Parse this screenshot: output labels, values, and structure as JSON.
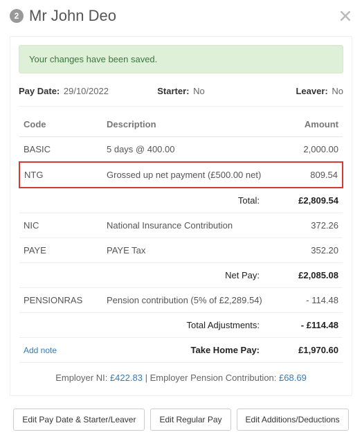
{
  "header": {
    "step_number": "2",
    "title": "Mr John Deo"
  },
  "alert": {
    "message": "Your changes have been saved."
  },
  "meta": {
    "pay_date_label": "Pay Date:",
    "pay_date_value": "29/10/2022",
    "starter_label": "Starter:",
    "starter_value": "No",
    "leaver_label": "Leaver:",
    "leaver_value": "No"
  },
  "table": {
    "head": {
      "code": "Code",
      "description": "Description",
      "amount": "Amount"
    },
    "groups": [
      {
        "rows": [
          {
            "code": "BASIC",
            "description": "5 days @ 400.00",
            "amount": "2,000.00",
            "highlight": false
          },
          {
            "code": "NTG",
            "description": "Grossed up net payment (£500.00 net)",
            "amount": "809.54",
            "highlight": true
          }
        ],
        "summary": {
          "label": "Total:",
          "amount": "£2,809.54"
        }
      },
      {
        "rows": [
          {
            "code": "NIC",
            "description": "National Insurance Contribution",
            "amount": "372.26",
            "highlight": false
          },
          {
            "code": "PAYE",
            "description": "PAYE Tax",
            "amount": "352.20",
            "highlight": false
          }
        ],
        "summary": {
          "label": "Net Pay:",
          "amount": "£2,085.08"
        }
      },
      {
        "rows": [
          {
            "code": "PENSIONRAS",
            "description": "Pension contribution (5% of £2,289.54)",
            "amount": "- 114.48",
            "highlight": false
          }
        ],
        "summary": {
          "label": "Total Adjustments:",
          "amount": "- £114.48"
        }
      }
    ],
    "final": {
      "left_link": "Add note",
      "label": "Take Home Pay:",
      "amount": "£1,970.60"
    }
  },
  "employer": {
    "ni_label": "Employer NI:",
    "ni_value": "£422.83",
    "separator": " | ",
    "pension_label": "Employer Pension Contribution:",
    "pension_value": "£68.69"
  },
  "buttons": {
    "edit_pay_date": "Edit Pay Date & Starter/Leaver",
    "edit_regular_pay": "Edit Regular Pay",
    "edit_add_ded": "Edit Additions/Deductions"
  }
}
